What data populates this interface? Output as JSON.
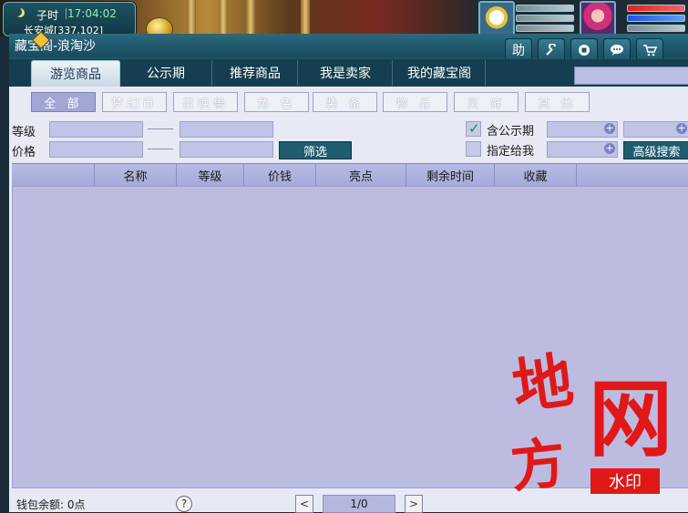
{
  "hud": {
    "hour": "子时",
    "time": "17:04:02",
    "location": "长安城[337,102]"
  },
  "window": {
    "title": "藏宝阁-浪淘沙",
    "toolbar": {
      "help_label": "助"
    }
  },
  "tabs": [
    {
      "label": "游览商品",
      "active": true
    },
    {
      "label": "公示期"
    },
    {
      "label": "推荐商品"
    },
    {
      "label": "我是卖家"
    },
    {
      "label": "我的藏宝阁"
    }
  ],
  "categories": [
    {
      "label": "全 部",
      "active": true
    },
    {
      "label": "梦幻币"
    },
    {
      "label": "召唤兽"
    },
    {
      "label": "角 色"
    },
    {
      "label": "装 备"
    },
    {
      "label": "物 品"
    },
    {
      "label": "灵 饰"
    },
    {
      "label": "其 他"
    }
  ],
  "filters": {
    "level_label": "等级",
    "price_label": "价格",
    "filter_button": "筛选",
    "include_public_label": "含公示期",
    "include_public_checked": true,
    "assigned_to_me_label": "指定给我",
    "assigned_to_me_checked": false,
    "advanced_search_button": "高级搜索"
  },
  "table": {
    "columns": [
      "",
      "名称",
      "等级",
      "价钱",
      "亮点",
      "剩余时间",
      "收藏",
      ""
    ],
    "rows": []
  },
  "footer": {
    "wallet_text": "钱包余额: 0点",
    "help_label": "?",
    "prev_label": "<",
    "next_label": ">",
    "page_text": "1/0"
  },
  "watermark": {
    "chars": [
      "地",
      "方",
      "网"
    ],
    "badge": "水印"
  },
  "colors": {
    "window_header": "#1e5468",
    "table_body": "#bbbce0",
    "watermark_red": "#e01818",
    "time_green": "#8cf2a0"
  },
  "icons": {
    "toolbar": [
      "help-icon",
      "wrench-icon",
      "record-icon",
      "chat-icon",
      "cart-icon"
    ]
  }
}
